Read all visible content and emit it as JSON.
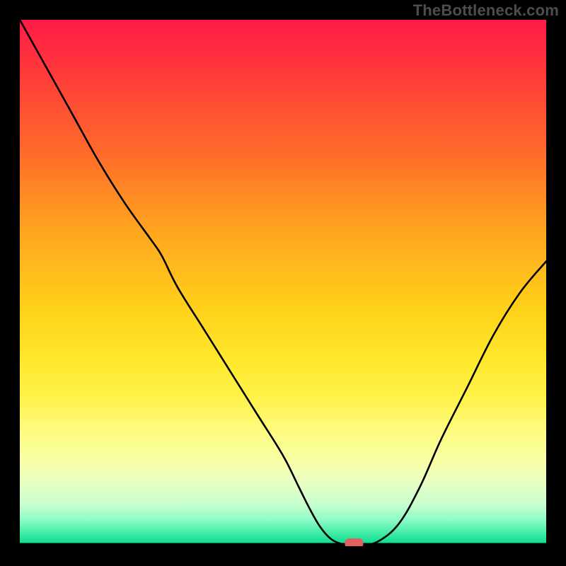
{
  "watermark": "TheBottleneck.com",
  "chart_data": {
    "type": "line",
    "title": "",
    "xlabel": "",
    "ylabel": "",
    "xlim": [
      0,
      100
    ],
    "ylim": [
      0,
      100
    ],
    "grid": false,
    "x": [
      0,
      5,
      10,
      15,
      20,
      25,
      27,
      30,
      35,
      40,
      45,
      50,
      53,
      55,
      57,
      59,
      61,
      63,
      65,
      68,
      72,
      76,
      80,
      85,
      90,
      95,
      100
    ],
    "values": [
      100,
      91,
      82,
      73,
      65,
      58,
      55,
      49,
      41,
      33,
      25,
      17,
      11,
      7,
      3.5,
      1.2,
      0.2,
      0,
      0,
      0.6,
      4,
      11,
      20,
      30,
      40,
      48,
      54
    ],
    "marker": {
      "x": 63.5,
      "y": 0
    },
    "background": {
      "gradient": "vertical",
      "stops": [
        {
          "pos": 0.0,
          "color": "#ff1a47"
        },
        {
          "pos": 0.55,
          "color": "#ffd21a"
        },
        {
          "pos": 0.8,
          "color": "#fffb80"
        },
        {
          "pos": 1.0,
          "color": "#00d88a"
        }
      ]
    }
  }
}
